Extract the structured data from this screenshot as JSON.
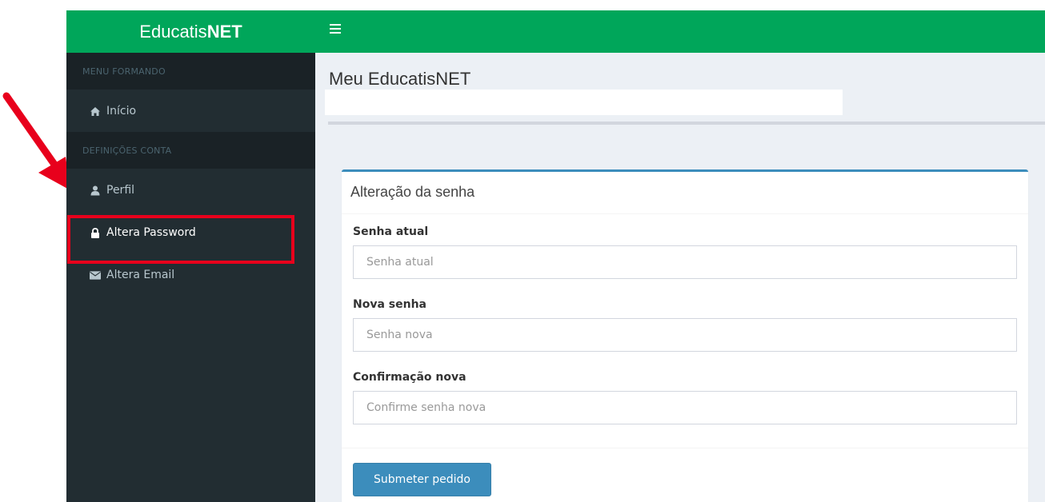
{
  "brand": {
    "name_regular": "Educatis",
    "name_bold": "NET"
  },
  "sidebar": {
    "sections": [
      {
        "header": "MENU FORMANDO"
      },
      {
        "header": "DEFINIÇÕES CONTA"
      }
    ],
    "items": [
      {
        "label": "Início",
        "icon": "home-icon"
      },
      {
        "label": "Perfil",
        "icon": "user-icon"
      },
      {
        "label": "Altera Password",
        "icon": "lock-icon"
      },
      {
        "label": "Altera Email",
        "icon": "envelope-icon"
      }
    ]
  },
  "page": {
    "title": "Meu EducatisNET"
  },
  "form": {
    "title": "Alteração da senha",
    "current": {
      "label": "Senha atual",
      "placeholder": "Senha atual"
    },
    "new": {
      "label": "Nova senha",
      "placeholder": "Senha nova"
    },
    "confirm": {
      "label": "Confirmação nova",
      "placeholder": "Confirme senha nova"
    },
    "submit_label": "Submeter pedido"
  },
  "colors": {
    "brand_green": "#00a65a",
    "sidebar_bg": "#222d32",
    "primary_blue": "#3c8dbc",
    "annotation_red": "#e8001c"
  }
}
